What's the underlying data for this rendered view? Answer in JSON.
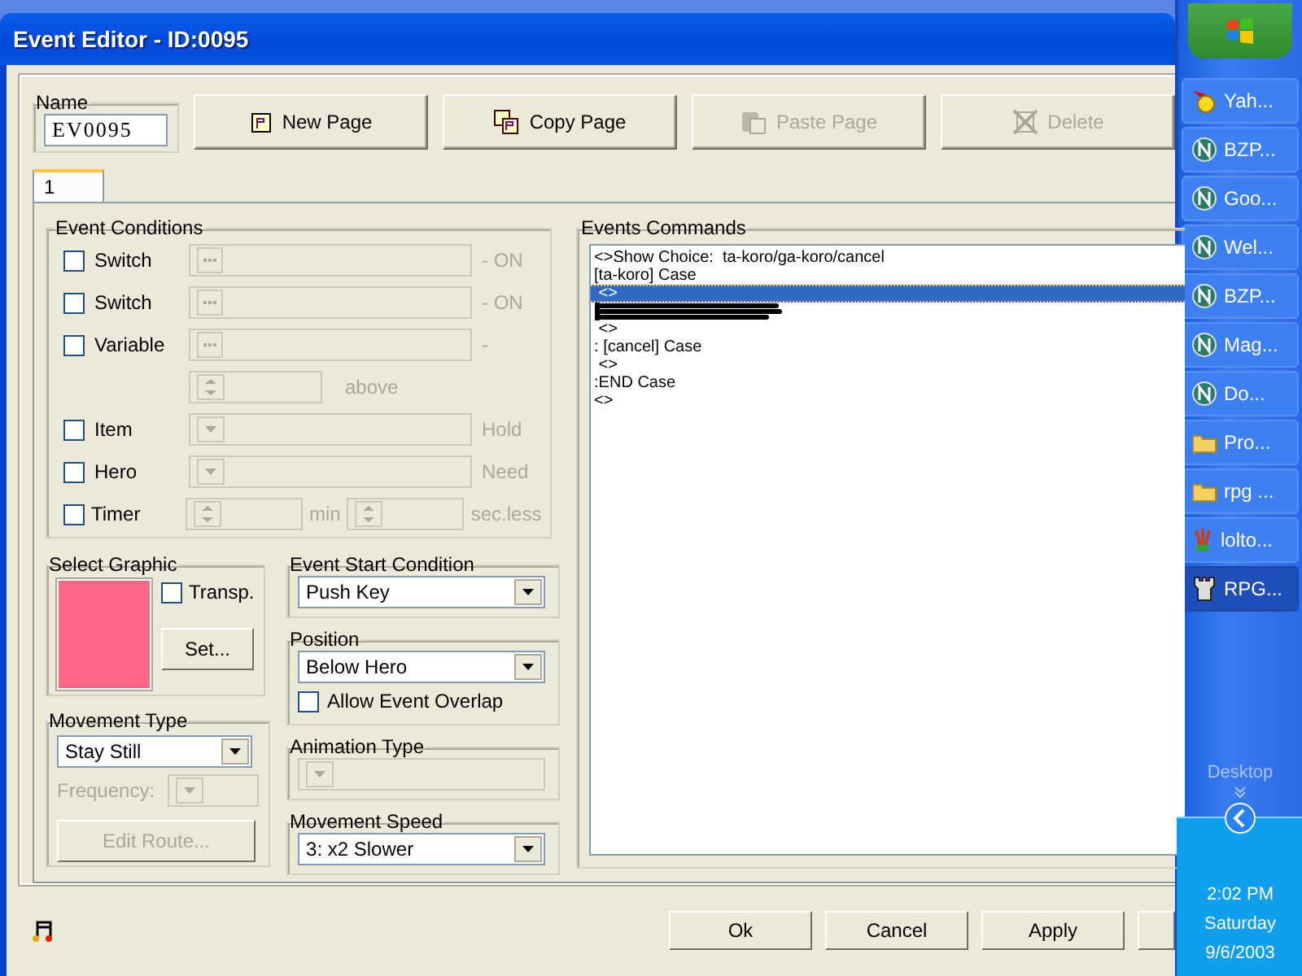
{
  "window": {
    "title": "Event Editor - ID:0095"
  },
  "name_field": {
    "label": "Name",
    "value": "EV0095"
  },
  "toolbar": [
    {
      "kind": "new",
      "label": "New Page",
      "disabled": false
    },
    {
      "kind": "copy",
      "label": "Copy Page",
      "disabled": false
    },
    {
      "kind": "paste",
      "label": "Paste Page",
      "disabled": true
    },
    {
      "kind": "delete",
      "label": "Delete",
      "disabled": true
    }
  ],
  "tabs": [
    {
      "label": "1",
      "selected": true
    }
  ],
  "event_conditions": {
    "title": "Event Conditions",
    "rows": [
      {
        "kind": "picker",
        "label": "Switch",
        "checked": false,
        "suffix": "- ON"
      },
      {
        "kind": "picker",
        "label": "Switch",
        "checked": false,
        "suffix": "- ON"
      },
      {
        "kind": "picker",
        "label": "Variable",
        "checked": false,
        "suffix": "-"
      },
      {
        "kind": "spin",
        "suffix": "above"
      },
      {
        "kind": "dropdown",
        "label": "Item",
        "checked": false,
        "suffix": "Hold"
      },
      {
        "kind": "dropdown",
        "label": "Hero",
        "checked": false,
        "suffix": "Need"
      },
      {
        "kind": "timer",
        "label": "Timer",
        "checked": false,
        "suffix": "min",
        "suffix_2": "sec.less"
      }
    ]
  },
  "graphic": {
    "title": "Select Graphic",
    "transparent": {
      "label": "Transp.",
      "checked": false
    },
    "set_button": "Set..."
  },
  "movement_type": {
    "title": "Movement Type",
    "value": "Stay Still",
    "frequency_label": "Frequency:",
    "edit_route": "Edit Route...",
    "disabled": true
  },
  "start_condition": {
    "title": "Event Start Condition",
    "value": "Push Key"
  },
  "position": {
    "title": "Position",
    "value": "Below Hero",
    "overlap": {
      "label": "Allow Event Overlap",
      "checked": false
    }
  },
  "animation_type": {
    "title": "Animation Type",
    "disabled": true
  },
  "movement_speed": {
    "title": "Movement Speed",
    "value": "3: x2 Slower"
  },
  "commands": {
    "title": "Events Commands",
    "lines": [
      {
        "text": "<>Show Choice:  ta-koro/ga-koro/cancel",
        "selected": false
      },
      {
        "text": "[ta-koro] Case",
        "selected": false
      },
      {
        "text": " <>",
        "selected": true
      },
      {
        "covered": true
      },
      {
        "text": " <>",
        "selected": false
      },
      {
        "text": ": [cancel] Case",
        "selected": false
      },
      {
        "text": " <>",
        "selected": false
      },
      {
        "text": ":END Case",
        "selected": false
      },
      {
        "text": "<>",
        "selected": false
      }
    ]
  },
  "footer_buttons": [
    {
      "label": "Ok"
    },
    {
      "label": "Cancel"
    },
    {
      "label": "Apply"
    }
  ],
  "taskbar": {
    "items": [
      {
        "kind": "messenger",
        "label": "Yah...",
        "selected": false
      },
      {
        "kind": "browser",
        "label": "BZP...",
        "selected": false
      },
      {
        "kind": "browser",
        "label": "Goo...",
        "selected": false
      },
      {
        "kind": "browser",
        "label": "Wel...",
        "selected": false
      },
      {
        "kind": "browser",
        "label": "BZP...",
        "selected": false
      },
      {
        "kind": "browser",
        "label": "Mag...",
        "selected": false
      },
      {
        "kind": "browser",
        "label": "Do...",
        "selected": false
      },
      {
        "kind": "folder",
        "label": "Pro...",
        "selected": false
      },
      {
        "kind": "folder",
        "label": "rpg ...",
        "selected": false
      },
      {
        "kind": "paint",
        "label": "lolto...",
        "selected": false
      },
      {
        "kind": "tower",
        "label": "RPG...",
        "selected": true
      }
    ],
    "desktop": "Desktop",
    "clock": {
      "time": "2:02 PM",
      "day": "Saturday",
      "date": "9/6/2003"
    }
  }
}
